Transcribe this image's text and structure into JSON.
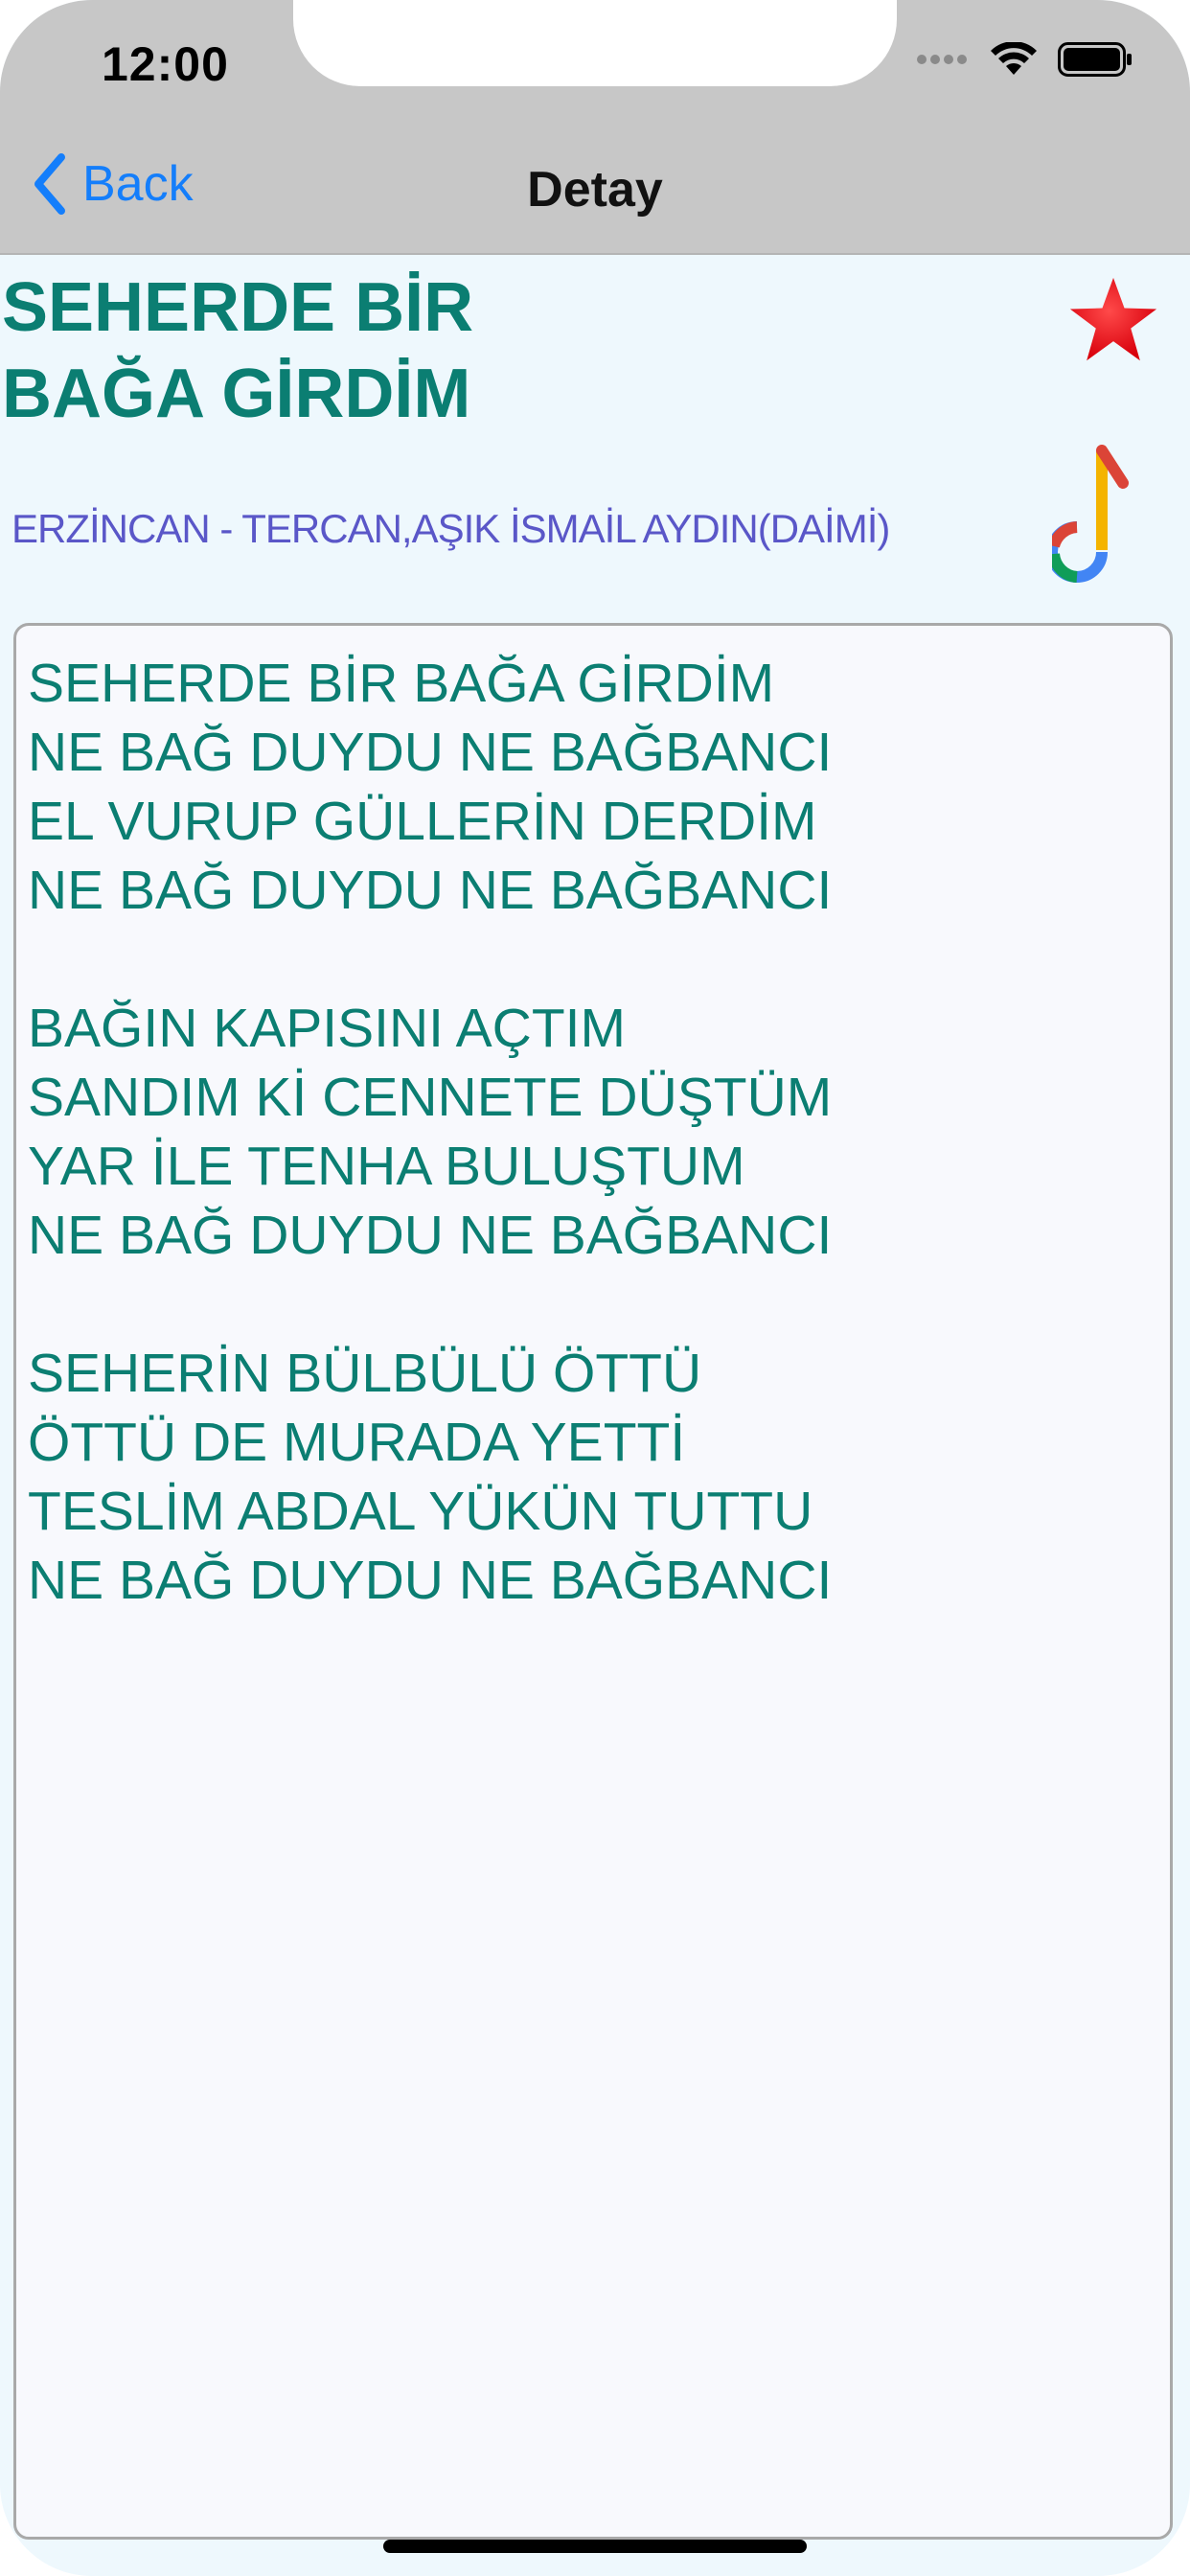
{
  "status_bar": {
    "time": "12:00",
    "icons": [
      "signal-dots-icon",
      "wifi-icon",
      "battery-icon"
    ]
  },
  "nav": {
    "back_label": "Back",
    "title": "Detay"
  },
  "song": {
    "title": "SEHERDE BİR\nBAĞA GİRDİM",
    "region": "ERZİNCAN - TERCAN,AŞIK İSMAİL AYDIN(DAİMİ)",
    "lyrics": "SEHERDE BİR BAĞA GİRDİM\nNE BAĞ DUYDU NE BAĞBANCI\nEL VURUP GÜLLERİN DERDİM\nNE BAĞ DUYDU NE BAĞBANCI\n\nBAĞIN KAPISINI AÇTIM\nSANDIM Kİ CENNETE DÜŞTÜM\nYAR İLE TENHA BULUŞTUM\nNE BAĞ DUYDU NE BAĞBANCI\n\nSEHERİN BÜLBÜLÜ ÖTTÜ\nÖTTÜ DE MURADA YETTİ\nTESLİM ABDAL YÜKÜN TUTTU\nNE BAĞ DUYDU NE BAĞBANCI"
  },
  "actions": {
    "favorite_icon": "star-icon",
    "music_icon": "music-note-icon"
  },
  "colors": {
    "title": "#0b7e72",
    "region": "#5a57c8",
    "accent": "#147efb",
    "star": "#e8101e",
    "navbar": "#c7c7c7",
    "background": "#eef8fd"
  }
}
